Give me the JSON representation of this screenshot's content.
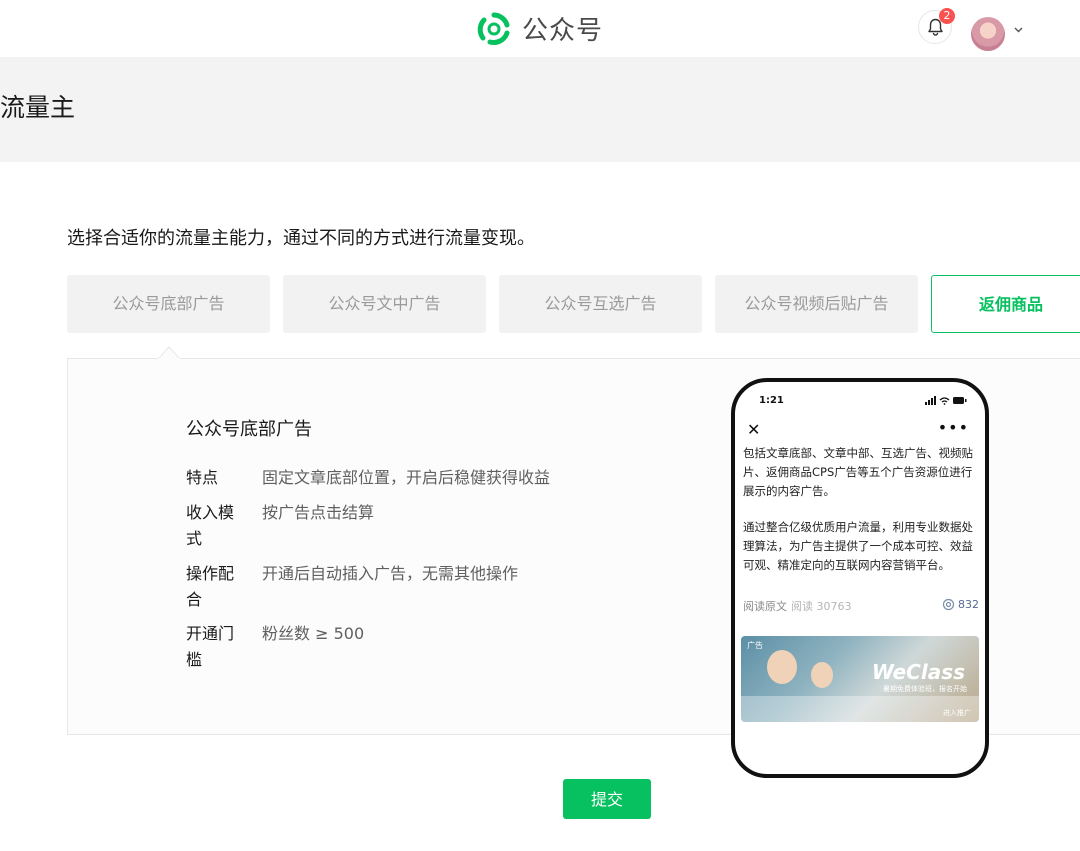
{
  "header": {
    "brand": "公众号",
    "notification_count": "2",
    "colors": {
      "brand_green": "#07c160",
      "badge_red": "#fa5151"
    }
  },
  "page": {
    "title": "流量主",
    "intro": "选择合适你的流量主能力，通过不同的方式进行流量变现。"
  },
  "tabs": [
    {
      "label": "公众号底部广告",
      "active": false
    },
    {
      "label": "公众号文中广告",
      "active": false
    },
    {
      "label": "公众号互选广告",
      "active": false
    },
    {
      "label": "公众号视频后贴广告",
      "active": false
    },
    {
      "label": "返佣商品",
      "active": true
    }
  ],
  "detail": {
    "title": "公众号底部广告",
    "rows": [
      {
        "label": "特点",
        "value": "固定文章底部位置，开启后稳健获得收益"
      },
      {
        "label": "收入模式",
        "value": "按广告点击结算"
      },
      {
        "label": "操作配合",
        "value": "开通后自动插入广告，无需其他操作"
      },
      {
        "label": "开通门槛",
        "value": "粉丝数 ≥ 500"
      }
    ]
  },
  "phone": {
    "time": "1:21",
    "close_icon": "close-icon",
    "more_icon": "more-icon",
    "paragraph1": "包括文章底部、文章中部、互选广告、视频贴片、返佣商品CPS广告等五个广告资源位进行展示的内容广告。",
    "paragraph2": "通过整合亿级优质用户流量，利用专业数据处理算法，为广告主提供了一个成本可控、效益可观、精准定向的互联网内容营销平台。",
    "read_original": "阅读原文",
    "read_count": "阅读 30763",
    "like_count": "832",
    "ad": {
      "tag": "广告",
      "brand": "WeClass",
      "subtitle": "暑期免费体验班，报名开始",
      "cta": "进入推广"
    }
  },
  "actions": {
    "submit": "提交"
  }
}
